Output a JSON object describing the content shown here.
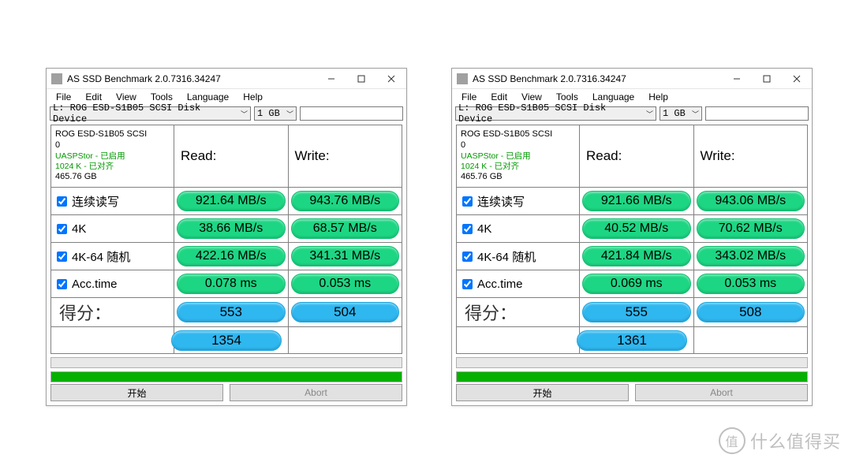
{
  "app_title": "AS SSD Benchmark 2.0.7316.34247",
  "menu": {
    "file": "File",
    "edit": "Edit",
    "view": "View",
    "tools": "Tools",
    "language": "Language",
    "help": "Help"
  },
  "device": "L: ROG ESD-S1B05 SCSI Disk Device",
  "size": "1 GB",
  "headers": {
    "read": "Read:",
    "write": "Write:"
  },
  "rows": {
    "seq": "连续读写",
    "k4": "4K",
    "k4_64": "4K-64 随机",
    "acc": "Acc.time",
    "score": "得分："
  },
  "buttons": {
    "start": "开始",
    "abort": "Abort"
  },
  "watermark": {
    "badge": "值",
    "text": "什么值得买"
  },
  "windows": [
    {
      "info": {
        "line1": "ROG ESD-S1B05 SCSI",
        "line2": "0",
        "line3": "UASPStor - 已启用",
        "line4": "1024 K - 已对齐",
        "line5": "465.76 GB"
      },
      "seq": {
        "read": "921.64 MB/s",
        "write": "943.76 MB/s"
      },
      "k4": {
        "read": "38.66 MB/s",
        "write": "68.57 MB/s"
      },
      "k4_64": {
        "read": "422.16 MB/s",
        "write": "341.31 MB/s"
      },
      "acc": {
        "read": "0.078 ms",
        "write": "0.053 ms"
      },
      "score": {
        "read": "553",
        "write": "504",
        "total": "1354"
      }
    },
    {
      "info": {
        "line1": "ROG ESD-S1B05 SCSI",
        "line2": "0",
        "line3": "UASPStor - 已启用",
        "line4": "1024 K - 已对齐",
        "line5": "465.76 GB"
      },
      "seq": {
        "read": "921.66 MB/s",
        "write": "943.06 MB/s"
      },
      "k4": {
        "read": "40.52 MB/s",
        "write": "70.62 MB/s"
      },
      "k4_64": {
        "read": "421.84 MB/s",
        "write": "343.02 MB/s"
      },
      "acc": {
        "read": "0.069 ms",
        "write": "0.053 ms"
      },
      "score": {
        "read": "555",
        "write": "508",
        "total": "1361"
      }
    }
  ]
}
